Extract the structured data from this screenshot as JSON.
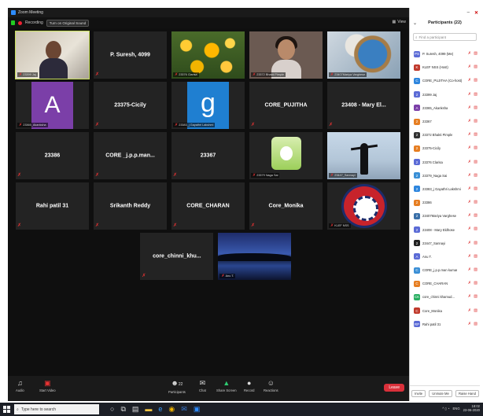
{
  "window": {
    "title": "Zoom Meeting",
    "min": "–",
    "max": "□",
    "close": "✕"
  },
  "topbar": {
    "recording": "Recording",
    "sound_button": "Turn on Original Sound",
    "view": "View"
  },
  "tiles": [
    {
      "id": "t1",
      "type": "video-person",
      "label": "23399 Jaj",
      "muted": true
    },
    {
      "id": "t2",
      "type": "name",
      "name": "P. Suresh, 4099",
      "muted": true
    },
    {
      "id": "t3",
      "type": "video-sunflower",
      "label": "23376 Clarisa",
      "muted": true
    },
    {
      "id": "t4",
      "type": "video-girl",
      "label": "23372 Bhakti Pimple",
      "muted": true
    },
    {
      "id": "t5",
      "type": "video-earth",
      "label": "23407Mariya Varghese",
      "muted": true
    },
    {
      "id": "t6",
      "type": "avatar-A",
      "letter": "A",
      "label": "23365_Akanksha",
      "muted": true
    },
    {
      "id": "t7",
      "type": "name",
      "name": "23375-Cicily",
      "muted": true
    },
    {
      "id": "t8",
      "type": "avatar-g",
      "letter": "g",
      "label": "23383_j Gayathri Lakshmi",
      "muted": true
    },
    {
      "id": "t9",
      "type": "name",
      "name": "CORE_PUJITHA",
      "muted": true
    },
    {
      "id": "t10",
      "type": "name",
      "name": "23408 - Mary El...",
      "muted": true
    },
    {
      "id": "t11",
      "type": "name",
      "name": "23386",
      "muted": true
    },
    {
      "id": "t12",
      "type": "name",
      "name": "CORE _j.p.p.man...",
      "muted": true
    },
    {
      "id": "t13",
      "type": "name",
      "name": "23367",
      "muted": true
    },
    {
      "id": "t14",
      "type": "video-apple",
      "label": "23379 Naga Sai",
      "muted": true
    },
    {
      "id": "t15",
      "type": "video-sky",
      "label": "23447_Sannayi",
      "muted": true
    },
    {
      "id": "t16",
      "type": "name",
      "name": "Rahi patil 31",
      "muted": true
    },
    {
      "id": "t17",
      "type": "name",
      "name": "Srikanth Reddy",
      "muted": true
    },
    {
      "id": "t18",
      "type": "name",
      "name": "CORE_CHARAN",
      "muted": true
    },
    {
      "id": "t19",
      "type": "name",
      "name": "Core_Monika",
      "muted": true
    },
    {
      "id": "t20",
      "type": "video-nss",
      "label": "KLEF NSS",
      "muted": true
    },
    {
      "id": "t21",
      "type": "name",
      "name": "core_chinni_khu...",
      "muted": true
    },
    {
      "id": "t22",
      "type": "video-lake",
      "label": "Anu T.",
      "muted": true
    }
  ],
  "toolbar": {
    "audio": "Audio",
    "video": "Start Video",
    "participants": "Participants",
    "participants_count": "22",
    "chat": "Chat",
    "share": "Share Screen",
    "record": "Record",
    "reactions": "Reactions",
    "leave": "Leave"
  },
  "participants_panel": {
    "title": "Participants (22)",
    "search_placeholder": "Find a participant",
    "items": [
      {
        "initials": "PS",
        "color": "#5b6bd6",
        "name": "P. Suresh, 4099 (Me)"
      },
      {
        "initials": "K",
        "color": "#c0392b",
        "name": "KLEF NSS (Host)"
      },
      {
        "initials": "C",
        "color": "#2e86de",
        "name": "CORE_PUJITHA (Co-host)"
      },
      {
        "initials": "2",
        "color": "#5b6bd6",
        "name": "23399 Jaj"
      },
      {
        "initials": "A",
        "color": "#7b3fa8",
        "name": "23365_Akanksha"
      },
      {
        "initials": "2",
        "color": "#e67e22",
        "name": "23367"
      },
      {
        "initials": "2",
        "color": "#333333",
        "name": "23372 Bhakti Pimple"
      },
      {
        "initials": "2",
        "color": "#e67e22",
        "name": "23375-Cicily"
      },
      {
        "initials": "2",
        "color": "#5b6bd6",
        "name": "23376 Clarisa"
      },
      {
        "initials": "2",
        "color": "#3a8fd6",
        "name": "23379_Naga Sai"
      },
      {
        "initials": "2",
        "color": "#2e86de",
        "name": "23383_j Gayathri Lakshmi"
      },
      {
        "initials": "2",
        "color": "#e67e22",
        "name": "23386"
      },
      {
        "initials": "2",
        "color": "#3a6fa8",
        "name": "23407Mariya Varghese"
      },
      {
        "initials": "2",
        "color": "#5b6bd6",
        "name": "23408 - Mary Eldhose"
      },
      {
        "initials": "2",
        "color": "#222222",
        "name": "23447_Sannayi"
      },
      {
        "initials": "A",
        "color": "#5b6bd6",
        "name": "Anu T."
      },
      {
        "initials": "C",
        "color": "#3a8fd6",
        "name": "CORE_j.p.p.man kumar"
      },
      {
        "initials": "C",
        "color": "#e67e22",
        "name": "CORE_CHARAN"
      },
      {
        "initials": "CK",
        "color": "#27ae60",
        "name": "core_chinni khamud..."
      },
      {
        "initials": "C",
        "color": "#c0392b",
        "name": "Core_Monika"
      },
      {
        "initials": "RP",
        "color": "#5b6bd6",
        "name": "Rahi patil 31"
      }
    ],
    "invite": "Invite",
    "unmute_me": "Unmute Me",
    "raise_hand": "Raise Hand"
  },
  "taskbar": {
    "search_placeholder": "Type here to search",
    "lang": "ENG",
    "time": "18:02",
    "date": "23-06-2020"
  }
}
